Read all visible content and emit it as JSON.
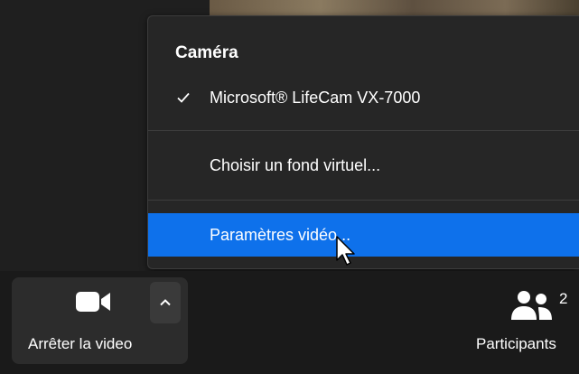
{
  "menu": {
    "heading": "Caméra",
    "camera_device": "Microsoft® LifeCam VX-7000",
    "virtual_background": "Choisir un fond virtuel...",
    "video_settings": "Paramètres vidéo..."
  },
  "toolbar": {
    "stop_video_label": "Arrêter la video",
    "participants_label": "Participants",
    "participants_count": "2"
  },
  "icons": {
    "check": "check-icon",
    "camera": "video-camera-icon",
    "chevron": "chevron-up-icon",
    "participants": "participants-icon",
    "cursor": "mouse-pointer-icon"
  },
  "colors": {
    "menu_bg": "#262626",
    "highlight": "#0e71eb",
    "toolbar_bg": "#1a1a1a"
  }
}
